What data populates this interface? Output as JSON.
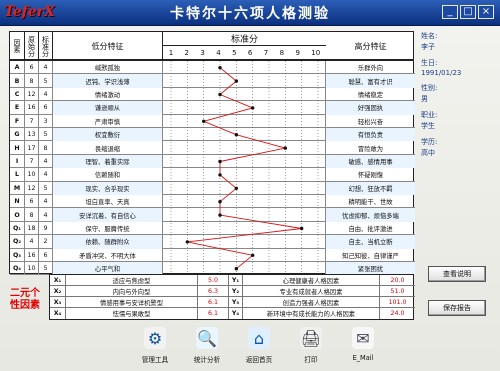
{
  "app": {
    "logo": "TeferX",
    "title": "卡特尔十六项人格测验",
    "window_controls": [
      "_",
      "□",
      "×"
    ]
  },
  "header": {
    "factor": "因素",
    "raw": "原始分",
    "std": "标准分",
    "low": "低分特征",
    "scale_title": "标准分",
    "ticks": [
      "1",
      "2",
      "3",
      "4",
      "5",
      "6",
      "7",
      "8",
      "9",
      "10"
    ],
    "high": "高分特征"
  },
  "rows": [
    {
      "factor": "A",
      "raw": "6",
      "std": "4",
      "low": "缄默孤独",
      "high": "乐群外向"
    },
    {
      "factor": "B",
      "raw": "8",
      "std": "5",
      "low": "迟钝、学识浅薄",
      "high": "聪慧、富有才识"
    },
    {
      "factor": "C",
      "raw": "12",
      "std": "4",
      "low": "情绪激动",
      "high": "情绪稳定"
    },
    {
      "factor": "E",
      "raw": "16",
      "std": "6",
      "low": "谦逊顺从",
      "high": "好强固执"
    },
    {
      "factor": "F",
      "raw": "7",
      "std": "3",
      "low": "严肃审慎",
      "high": "轻松兴奋"
    },
    {
      "factor": "G",
      "raw": "13",
      "std": "5",
      "low": "权宜敷衍",
      "high": "有恒负责"
    },
    {
      "factor": "H",
      "raw": "17",
      "std": "8",
      "low": "畏缩退缩",
      "high": "冒险敢为"
    },
    {
      "factor": "I",
      "raw": "7",
      "std": "4",
      "low": "理智、着重实际",
      "high": "敏感、感情用事"
    },
    {
      "factor": "L",
      "raw": "10",
      "std": "4",
      "low": "信赖随和",
      "high": "怀疑刚愎"
    },
    {
      "factor": "M",
      "raw": "12",
      "std": "5",
      "low": "现实、合乎现实",
      "high": "幻想、狂放不羁"
    },
    {
      "factor": "N",
      "raw": "6",
      "std": "4",
      "low": "坦白直率、天真",
      "high": "精明能干、世故"
    },
    {
      "factor": "O",
      "raw": "8",
      "std": "4",
      "low": "安详沉着、有自信心",
      "high": "忧虑抑郁、烦恼多端"
    },
    {
      "factor": "Q₁",
      "raw": "18",
      "std": "9",
      "low": "保守、服膺传统",
      "high": "自由、批评激进"
    },
    {
      "factor": "Q₂",
      "raw": "4",
      "std": "2",
      "low": "依赖、随群附众",
      "high": "自主、当机立断"
    },
    {
      "factor": "Q₃",
      "raw": "16",
      "std": "6",
      "low": "矛盾冲突、不明大体",
      "high": "知己知彼、自律谨严"
    },
    {
      "factor": "Q₄",
      "raw": "10",
      "std": "5",
      "low": "心平气和",
      "high": "紧张困扰"
    }
  ],
  "second_order": {
    "label": "二元个性因素",
    "rows": [
      {
        "xcode": "X₁",
        "xlabel": "适应与焦虑型",
        "xval": "5.0",
        "ycode": "Y₁",
        "ylabel": "心理健康者人格因素",
        "yval": "20.0"
      },
      {
        "xcode": "X₂",
        "xlabel": "内向与外向型",
        "xval": "6.3",
        "ycode": "Y₂",
        "ylabel": "专业有成就者人格因素",
        "yval": "51.0"
      },
      {
        "xcode": "X₃",
        "xlabel": "情感用事与安详机警型",
        "xval": "6.1",
        "ycode": "Y₃",
        "ylabel": "创造力强者人格因素",
        "yval": "101.0"
      },
      {
        "xcode": "X₄",
        "xlabel": "怯懦与果敢型",
        "xval": "6.1",
        "ycode": "Y₄",
        "ylabel": "新环境中有成长能力的人格因素",
        "yval": "24.0"
      }
    ]
  },
  "info": {
    "name_label": "姓名:",
    "name_value": "李子",
    "birth_label": "生日:",
    "birth_value": "1991/01/23",
    "sex_label": "性别:",
    "sex_value": "男",
    "job_label": "职业:",
    "job_value": "学生",
    "edu_label": "学历:",
    "edu_value": "高中"
  },
  "buttons": {
    "view_help": "查看说明",
    "save_report": "保存报告"
  },
  "toolbar": {
    "items": [
      {
        "label": "管理工具",
        "icon": "tools-icon"
      },
      {
        "label": "统计分析",
        "icon": "analysis-icon"
      },
      {
        "label": "返回首页",
        "icon": "home-icon"
      },
      {
        "label": "打印",
        "icon": "print-icon"
      },
      {
        "label": "E_Mail",
        "icon": "email-icon"
      }
    ]
  },
  "chart_data": {
    "type": "line",
    "title": "",
    "x_label": "标准分",
    "x_ticks": [
      1,
      2,
      3,
      4,
      5,
      6,
      7,
      8,
      9,
      10
    ],
    "categories": [
      "A",
      "B",
      "C",
      "E",
      "F",
      "G",
      "H",
      "I",
      "L",
      "M",
      "N",
      "O",
      "Q₁",
      "Q₂",
      "Q₃",
      "Q₄"
    ],
    "values": [
      4,
      5,
      4,
      6,
      3,
      5,
      8,
      4,
      4,
      5,
      4,
      4,
      9,
      2,
      6,
      5
    ],
    "xlim": [
      1,
      10
    ]
  }
}
